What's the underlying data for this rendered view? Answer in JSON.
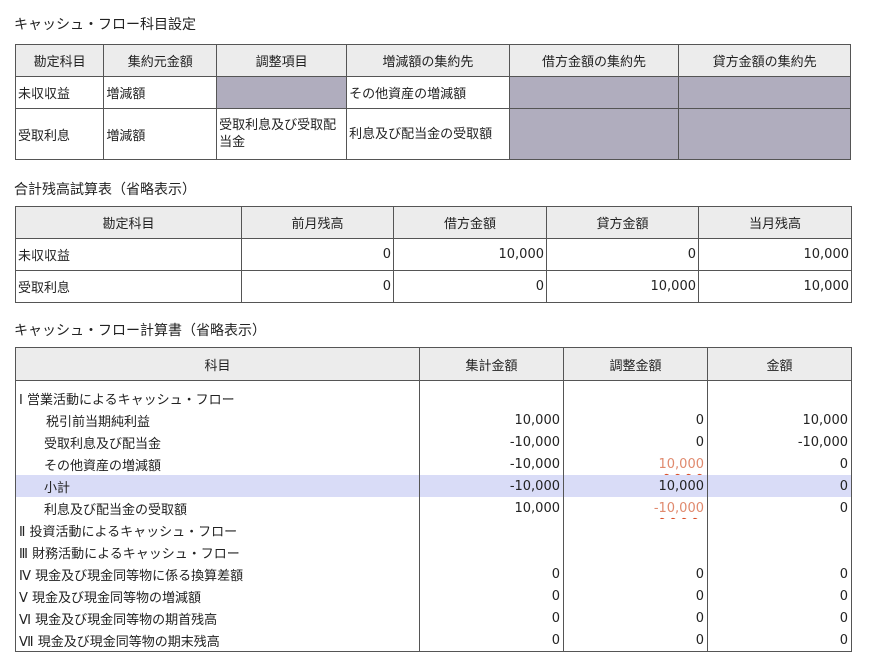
{
  "section1": {
    "title": "キャッシュ・フロー科目設定",
    "headers": [
      "勘定科目",
      "集約元金額",
      "調整項目",
      "増減額の集約先",
      "借方金額の集約先",
      "貸方金額の集約先"
    ],
    "rows": [
      [
        "未収収益",
        "増減額",
        "",
        "その他資産の増減額",
        "",
        ""
      ],
      [
        "受取利息",
        "増減額",
        "受取利息及び受取配当金",
        "利息及び配当金の受取額",
        "",
        ""
      ]
    ]
  },
  "section2": {
    "title": "合計残高試算表（省略表示）",
    "headers": [
      "勘定科目",
      "前月残高",
      "借方金額",
      "貸方金額",
      "当月残高"
    ],
    "rows": [
      [
        "未収収益",
        "0",
        "10,000",
        "0",
        "10,000"
      ],
      [
        "受取利息",
        "0",
        "0",
        "10,000",
        "10,000"
      ]
    ]
  },
  "section3": {
    "title": "キャッシュ・フロー計算書（省略表示）",
    "headers": [
      "科目",
      "集計金額",
      "調整金額",
      "金額"
    ],
    "rows": [
      {
        "label": "Ⅰ 営業活動によるキャッシュ・フロー",
        "sum": "",
        "adj": "",
        "amt": ""
      },
      {
        "label": "税引前当期純利益",
        "sum": "10,000",
        "adj": "0",
        "amt": "10,000"
      },
      {
        "label": "受取利息及び配当金",
        "sum": "-10,000",
        "adj": "0",
        "amt": "-10,000"
      },
      {
        "label": "その他資産の増減額",
        "sum": "-10,000",
        "adj": "10,000",
        "amt": "0"
      },
      {
        "label": "小計",
        "sum": "-10,000",
        "adj": "10,000",
        "amt": "0"
      },
      {
        "label": "利息及び配当金の受取額",
        "sum": "10,000",
        "adj": "-10,000",
        "amt": "0"
      },
      {
        "label": "Ⅱ 投資活動によるキャッシュ・フロー",
        "sum": "",
        "adj": "",
        "amt": ""
      },
      {
        "label": "Ⅲ 財務活動によるキャッシュ・フロー",
        "sum": "",
        "adj": "",
        "amt": ""
      },
      {
        "label": "Ⅳ 現金及び現金同等物に係る換算差額",
        "sum": "0",
        "adj": "0",
        "amt": "0"
      },
      {
        "label": "Ⅴ 現金及び現金同等物の増減額",
        "sum": "0",
        "adj": "0",
        "amt": "0"
      },
      {
        "label": "Ⅵ 現金及び現金同等物の期首残高",
        "sum": "0",
        "adj": "0",
        "amt": "0"
      },
      {
        "label": "Ⅶ 現金及び現金同等物の期末残高",
        "sum": "0",
        "adj": "0",
        "amt": "0"
      }
    ]
  },
  "colors": {
    "input_cell_gray": "#b0adbe",
    "header_bg": "#ececec",
    "highlight_row": "#d9dcf7",
    "adjust_text": "#e08a6e",
    "squiggle": "#d9502a"
  }
}
